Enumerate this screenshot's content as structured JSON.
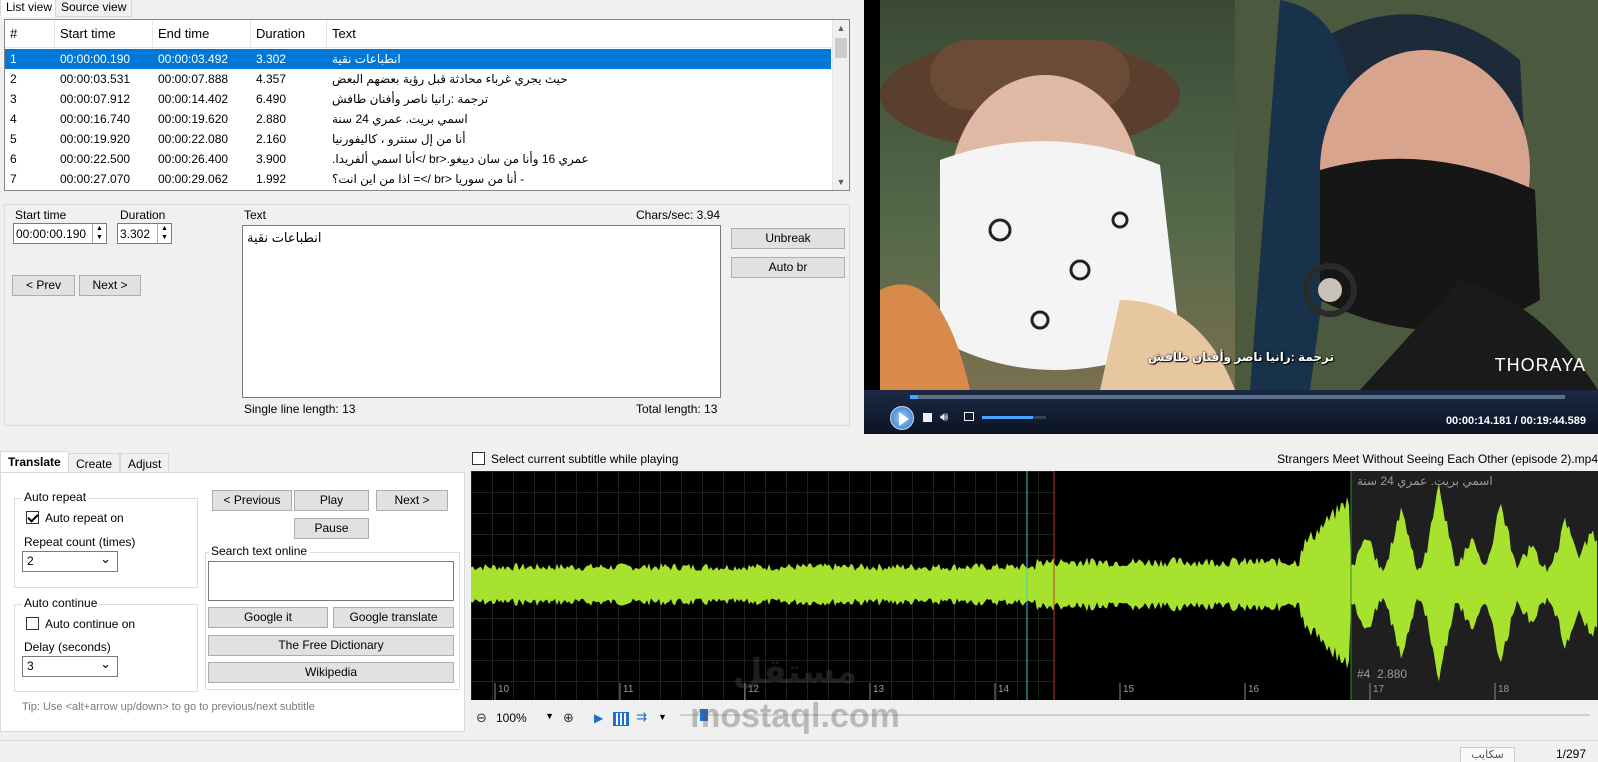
{
  "top_tabs": [
    "List view",
    "Source view"
  ],
  "grid": {
    "columns": [
      "#",
      "Start time",
      "End time",
      "Duration",
      "Text"
    ],
    "rows": [
      {
        "num": "1",
        "start": "00:00:00.190",
        "end": "00:00:03.492",
        "duration": "3.302",
        "text": "انطباعات نقية"
      },
      {
        "num": "2",
        "start": "00:00:03.531",
        "end": "00:00:07.888",
        "duration": "4.357",
        "text": "حيث يجري غرباء محادثة قبل رؤية بعضهم البعض"
      },
      {
        "num": "3",
        "start": "00:00:07.912",
        "end": "00:00:14.402",
        "duration": "6.490",
        "text": "ترجمة :رانيا ناصر وأفنان طافش"
      },
      {
        "num": "4",
        "start": "00:00:16.740",
        "end": "00:00:19.620",
        "duration": "2.880",
        "text": "اسمي بريت.  عمري 24 سنة"
      },
      {
        "num": "5",
        "start": "00:00:19.920",
        "end": "00:00:22.080",
        "duration": "2.160",
        "text": "أنا من إل سنترو ، كاليفورنيا"
      },
      {
        "num": "6",
        "start": "00:00:22.500",
        "end": "00:00:26.400",
        "duration": "3.900",
        "text": "عمري 16 وأنا من سان دييغو.<br />أنا اسمي ألفريدا."
      },
      {
        "num": "7",
        "start": "00:00:27.070",
        "end": "00:00:29.062",
        "duration": "1.992",
        "text": "- أنا من سوريا <br />= اذا من اين انت؟"
      }
    ]
  },
  "editor": {
    "start_time_label": "Start time",
    "start_time_value": "00:00:00.190",
    "duration_label": "Duration",
    "duration_value": "3.302",
    "text_label": "Text",
    "chars_sec": "Chars/sec: 3.94",
    "text_value": "انطباعات نقية",
    "single_line_length": "Single line length: 13",
    "total_length": "Total length: 13",
    "prev": "< Prev",
    "next": "Next >",
    "unbreak": "Unbreak",
    "auto_br": "Auto br"
  },
  "video": {
    "subtitle": "ترجمة :رانيا ناصر وأفنان طافش",
    "watermark": "THORAYA",
    "time": "00:00:14.181 / 00:19:44.589",
    "progress_fraction": 0.012,
    "volume_fraction": 0.8
  },
  "bottom_tabs": [
    "Translate",
    "Create",
    "Adjust"
  ],
  "translate": {
    "auto_repeat_title": "Auto repeat",
    "auto_repeat_on": "Auto repeat on",
    "repeat_count_label": "Repeat count (times)",
    "repeat_count_value": "2",
    "auto_continue_title": "Auto continue",
    "auto_continue_on": "Auto continue on",
    "delay_label": "Delay (seconds)",
    "delay_value": "3",
    "previous": "< Previous",
    "play": "Play",
    "next": "Next >",
    "pause": "Pause",
    "search_online_label": "Search text online",
    "google_it": "Google it",
    "google_translate": "Google translate",
    "free_dictionary": "The Free Dictionary",
    "wikipedia": "Wikipedia",
    "tip": "Tip: Use <alt+arrow up/down> to go to previous/next subtitle"
  },
  "waveform": {
    "select_current": "Select current subtitle while playing",
    "filename": "Strangers Meet Without Seeing Each Other (episode 2).mp4",
    "subtitle_text": "اسمي بريت. عمري 24 سنة",
    "subtitle_info": "#4  2.880",
    "ticks": [
      "10",
      "11",
      "12",
      "13",
      "14",
      "15",
      "16",
      "17",
      "18"
    ],
    "zoom": "100%"
  },
  "status": {
    "skype": "سكايب",
    "count": "1/297"
  },
  "watermark_logo": "مستقل mostaql.com",
  "colors": {
    "accent": "#0078d7",
    "wave": "#a6e22e",
    "selected_region": "#2a2a2a"
  }
}
